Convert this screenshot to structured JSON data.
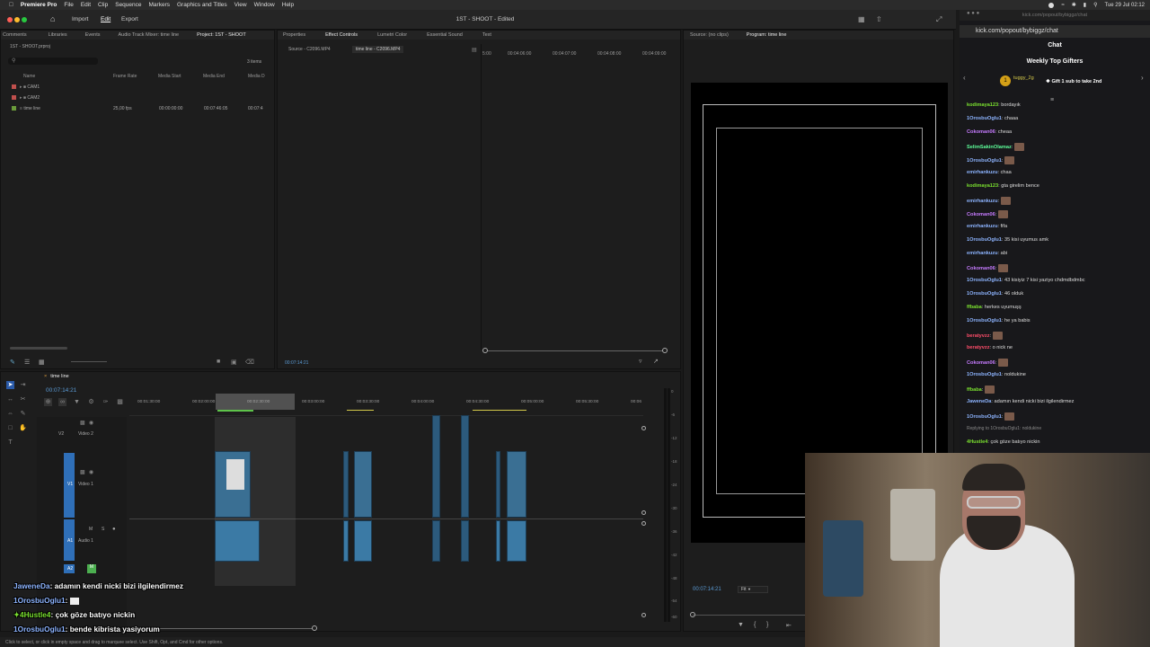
{
  "menubar": {
    "app_name": "Premiere Pro",
    "items": [
      "File",
      "Edit",
      "Clip",
      "Sequence",
      "Markers",
      "Graphics and Titles",
      "View",
      "Window",
      "Help"
    ],
    "clock": "Tue 29 Jul  02:12"
  },
  "workspace": {
    "import": "Import",
    "edit": "Edit",
    "export": "Export",
    "document_title": "1ST - SHOOT - Edited"
  },
  "project_panel": {
    "tabs": [
      "Comments",
      "Libraries",
      "Events",
      "Audio Track Mixer: time line",
      "Project: 1ST - SHOOT"
    ],
    "project_file": "1ST - SHOOT.prproj",
    "item_count": "3 items",
    "columns": [
      "Name",
      "Frame Rate",
      "Media Start",
      "Media End",
      "Media D"
    ],
    "items": [
      {
        "name": "CAM1",
        "frame_rate": "",
        "media_start": "",
        "media_end": "",
        "color": "#c0504d"
      },
      {
        "name": "CAM2",
        "frame_rate": "",
        "media_start": "",
        "media_end": "",
        "color": "#c0504d"
      },
      {
        "name": "time line",
        "frame_rate": "25,00 fps",
        "media_start": "00:00:00:00",
        "media_end": "00:07:46:05",
        "media_d": "00:07:4",
        "color": "#6a9a3a"
      }
    ]
  },
  "effect_panel": {
    "tabs": [
      "Properties",
      "Effect Controls",
      "Lumetri Color",
      "Essential Sound",
      "Text"
    ],
    "sources": [
      "Source - C2096.MP4",
      "time line - C2096.MP4"
    ],
    "ruler": [
      "5:00",
      "00:04:06:00",
      "00:04:07:00",
      "00:04:08:00",
      "00:04:09:00"
    ],
    "timecode": "00:07:14:21"
  },
  "program_panel": {
    "source_tab": "Source: (no clips)",
    "program_tab": "Program: time line",
    "timecode": "00:07:14:21",
    "fit": "Fit"
  },
  "timeline": {
    "tab": "time line",
    "timecode": "00:07:14:21",
    "ruler": [
      "00:01:30:00",
      "00:02:00:00",
      "00:02:30:00",
      "00:03:00:00",
      "00:03:30:00",
      "00:04:00:00",
      "00:04:30:00",
      "00:05:00:00",
      "00:05:30:00",
      "00:06"
    ],
    "tracks": {
      "v2": "V2",
      "v2_label": "Video 2",
      "v1": "V1",
      "v1_label": "Video 1",
      "a1": "A1",
      "a1_label": "Audio 1",
      "a2": "A2"
    },
    "meter_ticks": [
      "0",
      "-6",
      "-12",
      "-18",
      "-24",
      "-30",
      "-36",
      "-42",
      "-48",
      "-54",
      "-60"
    ]
  },
  "status_bar": "Click to select, or click in empty space and drag to marquee select. Use Shift, Opt, and Cmd for other options.",
  "browser": {
    "url": "kick.com/popout/bybiggz/chat",
    "url_faded": "kick.com/popout/bybiggz/chat"
  },
  "chat": {
    "title": "Chat",
    "gifters_title": "Weekly Top Gifters",
    "top_gifter": "tuggy_2g",
    "gift_prompt": "Gift 1 sub to take 2nd",
    "messages": [
      {
        "user": "kodimaya123",
        "text": "bordayık",
        "color": "#7ae02f"
      },
      {
        "user": "1OrosbuOglu1",
        "text": "chaaa",
        "color": "#8db4ff"
      },
      {
        "user": "Cokoman06",
        "text": "cheaa",
        "color": "#c67bff"
      },
      {
        "user": "SelimSakinOlamaz",
        "text": "",
        "color": "#5dff9a"
      },
      {
        "user": "1OrosbuOglu1",
        "text": "",
        "color": "#8db4ff"
      },
      {
        "user": "emirhankuzu",
        "text": "chaa",
        "color": "#8db4ff"
      },
      {
        "user": "kodimaya123",
        "text": "gta girelim bence",
        "color": "#7ae02f"
      },
      {
        "user": "emirhankuzu",
        "text": "",
        "color": "#8db4ff"
      },
      {
        "user": "Cokoman06",
        "text": "",
        "color": "#c67bff"
      },
      {
        "user": "emirhankuzu",
        "text": "fifa",
        "color": "#8db4ff"
      },
      {
        "user": "1OrosbuOglu1",
        "text": "35 kisi uyumus amk",
        "color": "#8db4ff"
      },
      {
        "user": "emirhankuzu",
        "text": "abi",
        "color": "#8db4ff"
      },
      {
        "user": "Cokoman06",
        "text": "",
        "color": "#c67bff"
      },
      {
        "user": "1OrosbuOglu1",
        "text": "43 kisiyiz 7 kisi yaziyo chdmdbdmbc",
        "color": "#8db4ff"
      },
      {
        "user": "1OrosbuOglu1",
        "text": "46 olduk",
        "color": "#8db4ff"
      },
      {
        "user": "ffbaba",
        "text": "herkes uyumuşş",
        "color": "#7ae02f"
      },
      {
        "user": "1OrosbuOglu1",
        "text": "he ya babis",
        "color": "#8db4ff"
      },
      {
        "user": "beratyvzz",
        "text": "",
        "color": "#ff4d6a"
      },
      {
        "user": "beratyvzz",
        "text": "o nick ne",
        "color": "#ff4d6a"
      },
      {
        "user": "Cokoman06",
        "text": "",
        "color": "#c67bff"
      },
      {
        "user": "1OrosbuOglu1",
        "text": "noldukine",
        "color": "#8db4ff"
      },
      {
        "user": "ffbaba",
        "text": "",
        "color": "#7ae02f"
      },
      {
        "user": "JaweneDa",
        "text": "adamın kendi nicki bizi ilgilendirmez",
        "color": "#8db4ff"
      },
      {
        "user": "1OrosbuOglu1",
        "text": "",
        "color": "#8db4ff"
      },
      {
        "user": "reply",
        "text": "Replying to 1OrosbuOglu1: noldukine",
        "color": "#888"
      },
      {
        "user": "4Hustle4",
        "text": "çok göze batıyo nickin",
        "color": "#7ae02f"
      },
      {
        "user": "1OrosbuOglu1",
        "text": "bende kibrista yasiyorum",
        "color": "#8db4ff"
      }
    ]
  },
  "overlay_chat": [
    {
      "user": "JaweneDa",
      "text": "adamın kendi nicki bizi ilgilendirmez"
    },
    {
      "user": "1OrosbuOglu1",
      "text": ""
    },
    {
      "user": "4Hustle4",
      "text": "çok göze batıyo nickin"
    },
    {
      "user": "1OrosbuOglu1",
      "text": "bende kibrista yasiyorum"
    }
  ]
}
